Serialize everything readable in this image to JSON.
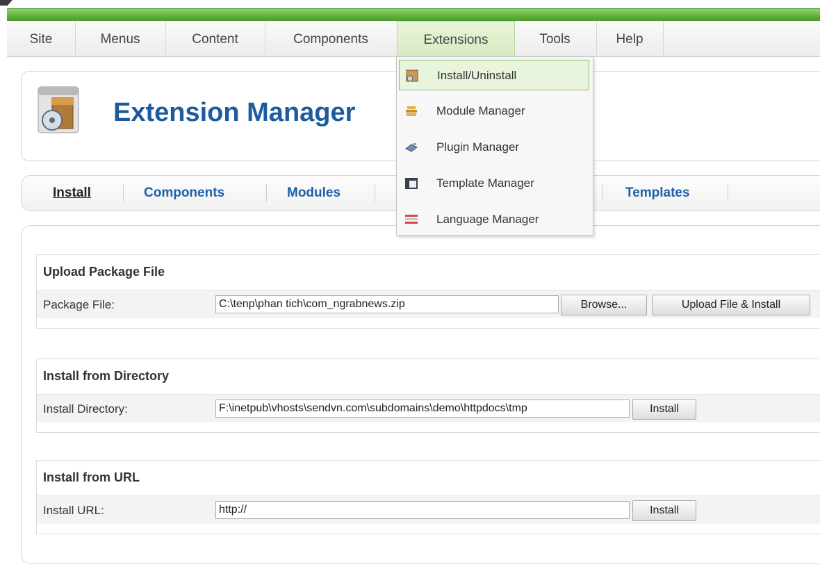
{
  "menubar": {
    "items": [
      "Site",
      "Menus",
      "Content",
      "Components",
      "Extensions",
      "Tools",
      "Help"
    ],
    "active": "Extensions"
  },
  "dropdown": {
    "items": [
      {
        "label": "Install/Uninstall",
        "icon": "install-icon"
      },
      {
        "label": "Module Manager",
        "icon": "module-icon"
      },
      {
        "label": "Plugin Manager",
        "icon": "plugin-icon"
      },
      {
        "label": "Template Manager",
        "icon": "template-icon"
      },
      {
        "label": "Language Manager",
        "icon": "language-icon"
      }
    ],
    "hovered": "Install/Uninstall"
  },
  "header": {
    "title": "Extension Manager",
    "icon": "extension-manager-icon"
  },
  "tabs": {
    "items": [
      "Install",
      "Components",
      "Modules",
      "Templates"
    ],
    "current": "Install"
  },
  "upload": {
    "title": "Upload Package File",
    "label": "Package File:",
    "value": "C:\\tenp\\phan tich\\com_ngrabnews.zip",
    "browse_label": "Browse...",
    "submit_label": "Upload File & Install"
  },
  "directory": {
    "title": "Install from Directory",
    "label": "Install Directory:",
    "value": "F:\\inetpub\\vhosts\\sendvn.com\\subdomains\\demo\\httpdocs\\tmp",
    "submit_label": "Install"
  },
  "url": {
    "title": "Install from URL",
    "label": "Install URL:",
    "value": "http://",
    "submit_label": "Install"
  },
  "colors": {
    "accent_green": "#5fb13a",
    "title_blue": "#1d5a9e",
    "link_blue": "#1d5fa8"
  }
}
